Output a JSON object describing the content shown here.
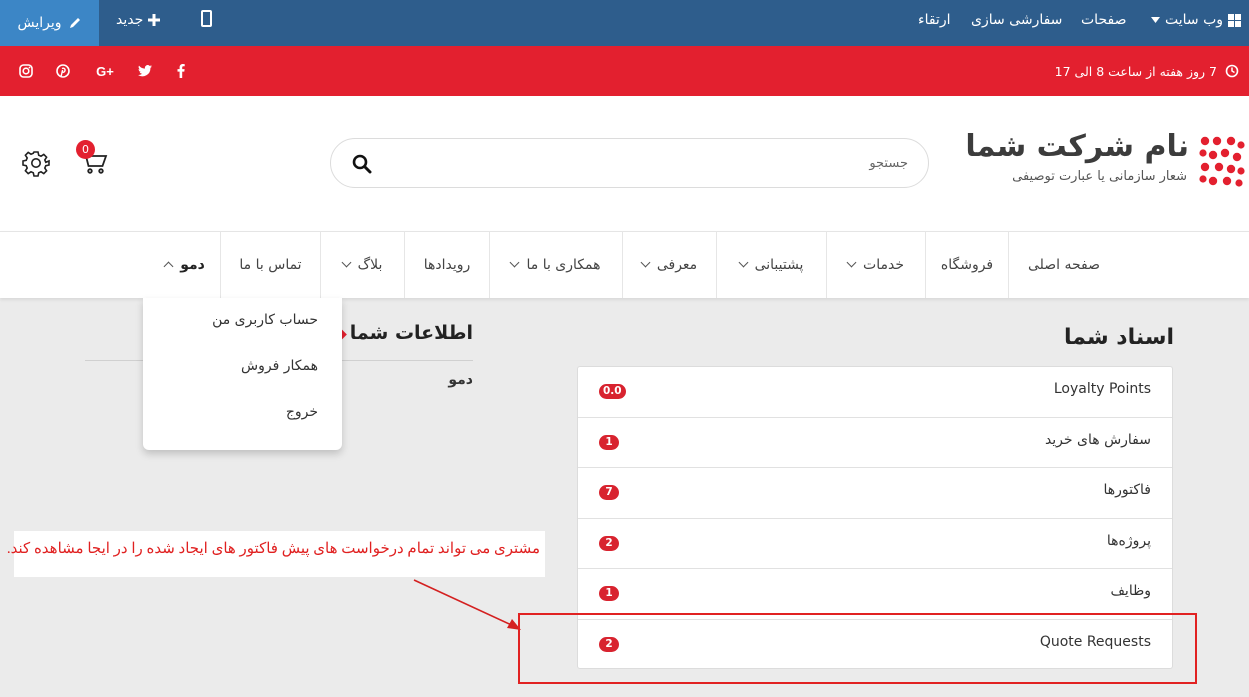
{
  "admin_bar": {
    "edit": "ویرایش",
    "new": "جدید",
    "website": "وب سایت",
    "pages": "صفحات",
    "customize": "سفارشی سازی",
    "upgrade": "ارتقاء"
  },
  "top_bar": {
    "hours": "7 روز هفته از ساعت 8 الی 17",
    "social": [
      "instagram-icon",
      "pinterest-icon",
      "google-plus-icon",
      "twitter-icon",
      "facebook-icon"
    ],
    "google_plus_glyph": "G+"
  },
  "header": {
    "logo_title": "نام شرکت شما",
    "logo_tagline": "شعار سازمانی یا عبارت توصیفی",
    "search_placeholder": "جستجو",
    "cart_count": "0"
  },
  "nav": {
    "items": [
      {
        "label": "صفحه اصلی"
      },
      {
        "label": "فروشگاه"
      },
      {
        "label": "خدمات"
      },
      {
        "label": "پشتیبانی"
      },
      {
        "label": "معرفی"
      },
      {
        "label": "همکاری با ما"
      },
      {
        "label": "رویدادها"
      },
      {
        "label": "بلاگ"
      },
      {
        "label": "تماس با ما"
      },
      {
        "label": "دمو"
      }
    ]
  },
  "user_menu": {
    "items": [
      "حساب کاربری من",
      "همکار فروش",
      "خروج"
    ]
  },
  "info": {
    "title": "اطلاعات شما",
    "name": "دمو"
  },
  "documents": {
    "title": "اسناد شما",
    "rows": [
      {
        "label": "Loyalty Points",
        "count": "0.0"
      },
      {
        "label": "سفارش های خرید",
        "count": "1"
      },
      {
        "label": "فاکتورها",
        "count": "7"
      },
      {
        "label": "پروژه‌ها",
        "count": "2"
      },
      {
        "label": "وظایف",
        "count": "1"
      },
      {
        "label": "Quote Requests",
        "count": "2"
      }
    ]
  },
  "annotation": {
    "text": "مشتری می تواند تمام درخواست های پیش فاکتور های ایجاد شده را در ایجا مشاهده کند."
  },
  "colors": {
    "admin_bar": "#2e5d8c",
    "edit_button": "#3c86c6",
    "accent_red": "#e3202f",
    "badge": "#d8232f"
  }
}
